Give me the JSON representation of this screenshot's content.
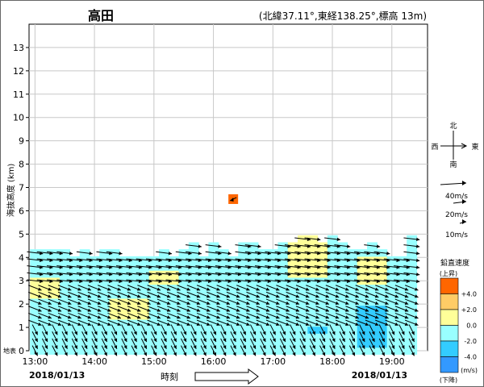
{
  "header": {
    "station": "高田",
    "location": "(北緯37.11°,東経138.25°,標高 13m)"
  },
  "footer": {
    "date_left": "2018/01/13",
    "date_right": "2018/01/13",
    "time_label": "時刻"
  },
  "compass": {
    "north": "北",
    "south": "南",
    "east": "東",
    "west": "西"
  },
  "wind_scale": [
    {
      "label": "40m/s",
      "speed": 40
    },
    {
      "label": "20m/s",
      "speed": 20
    },
    {
      "label": "10m/s",
      "speed": 10
    }
  ],
  "color_legend": {
    "title": "鉛直速度",
    "upper": "(上昇)",
    "lower": "(下降)",
    "unit": "(m/s)",
    "bins": [
      {
        "label": "+4.0",
        "color": "#ff6600"
      },
      {
        "label": "+2.0",
        "color": "#ffcc66"
      },
      {
        "label": "0.0",
        "color": "#ffff99"
      },
      {
        "label": "-2.0",
        "color": "#99ffff"
      },
      {
        "label": "-4.0",
        "color": "#33ccff"
      },
      {
        "label": "",
        "color": "#3399ff"
      }
    ]
  },
  "chart_data": {
    "type": "wind-profile",
    "ylabel": "海抜高度 (km)",
    "ground_label": "地表",
    "x_ticks": [
      "13:00",
      "14:00",
      "15:00",
      "16:00",
      "17:00",
      "18:00",
      "19:00"
    ],
    "x_range_hours": [
      12.9,
      19.6
    ],
    "ylim": [
      0,
      14
    ],
    "y_ticks": [
      0,
      1,
      2,
      3,
      4,
      5,
      6,
      7,
      8,
      9,
      10,
      11,
      12,
      13
    ],
    "grid": true,
    "sample_interval_min": 10,
    "level_step_km": 0.3,
    "top_height_km": [
      4.3,
      4.3,
      4.3,
      4.3,
      4.0,
      4.3,
      4.0,
      4.3,
      4.3,
      4.0,
      4.0,
      4.0,
      4.0,
      4.3,
      4.0,
      4.3,
      4.6,
      4.0,
      4.6,
      4.3,
      4.0,
      4.6,
      4.6,
      4.3,
      4.3,
      4.6,
      4.6,
      4.9,
      4.9,
      4.6,
      4.9,
      4.6,
      4.3,
      4.3,
      4.6,
      4.3,
      4.0,
      4.0,
      4.9
    ],
    "wind_regimes": [
      {
        "from_km": 0.0,
        "to_km": 1.2,
        "direction": "from-north-northwest",
        "speed_ms": 18
      },
      {
        "from_km": 1.2,
        "to_km": 3.0,
        "direction": "from-west-northwest",
        "speed_ms": 22
      },
      {
        "from_km": 3.0,
        "to_km": 5.0,
        "direction": "from-west",
        "speed_ms": 25
      }
    ],
    "updraft_zones": [
      {
        "from": "13:00",
        "to": "13:20",
        "bottom_km": 2.4,
        "top_km": 3.0,
        "w": 1
      },
      {
        "from": "14:20",
        "to": "14:50",
        "bottom_km": 1.4,
        "top_km": 2.3,
        "w": 1
      },
      {
        "from": "15:00",
        "to": "15:20",
        "bottom_km": 2.8,
        "top_km": 3.4,
        "w": 1
      },
      {
        "from": "17:20",
        "to": "17:50",
        "bottom_km": 3.1,
        "top_km": 4.8,
        "w": 1
      },
      {
        "from": "18:30",
        "to": "18:50",
        "bottom_km": 2.9,
        "top_km": 4.0,
        "w": 1
      }
    ],
    "downdraft_zones": [
      {
        "from": "17:40",
        "to": "17:50",
        "bottom_km": 0.8,
        "top_km": 1.1,
        "w": -3
      },
      {
        "from": "18:30",
        "to": "18:50",
        "bottom_km": 0.2,
        "top_km": 1.8,
        "w": -3
      }
    ],
    "outlier": {
      "time": "16:20",
      "height_km": 6.5,
      "w": 5
    }
  }
}
